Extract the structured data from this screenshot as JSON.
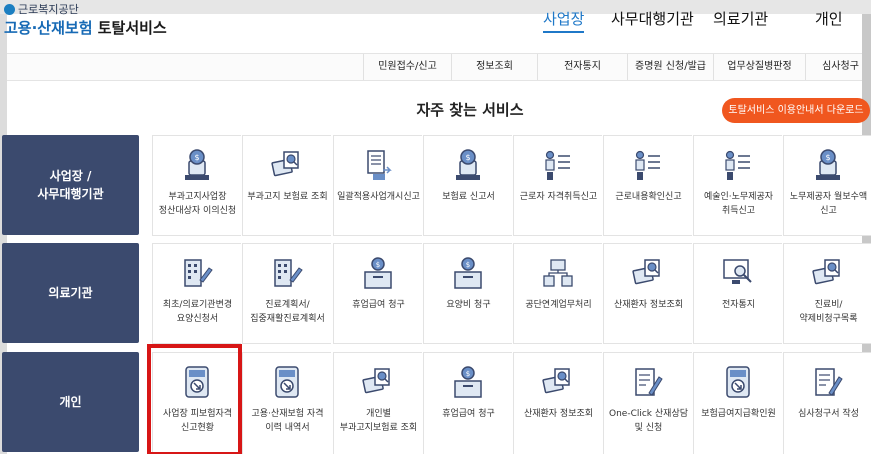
{
  "header": {
    "org_name": "근로복지공단",
    "service_name_part1": "고용·산재보험",
    "service_name_part2": "토탈서비스",
    "nav": [
      {
        "label": "사업장",
        "active": true
      },
      {
        "label": "사무대행기관",
        "active": false
      },
      {
        "label": "의료기관",
        "active": false
      },
      {
        "label": "개인",
        "active": false
      }
    ]
  },
  "subnav": [
    "민원접수/신고",
    "정보조회",
    "전자통지",
    "증명원 신청/발급",
    "업무상질병판정",
    "심사청구"
  ],
  "main": {
    "title": "자주 찾는 서비스",
    "download_button": "토탈서비스 이용안내서 다운로드"
  },
  "rows": [
    {
      "label_line1": "사업장 /",
      "label_line2": "사무대행기관",
      "tiles": [
        {
          "label": "부과고지사업장 정산대상자 이의신청",
          "icon": "money-bag-icon"
        },
        {
          "label": "부과고지 보험료 조회",
          "icon": "card-search-icon"
        },
        {
          "label": "일괄적용사업개시신고",
          "icon": "document-arrow-icon"
        },
        {
          "label": "보험료 신고서",
          "icon": "money-bag-icon"
        },
        {
          "label": "근로자 자격취득신고",
          "icon": "people-list-icon"
        },
        {
          "label": "근로내용확인신고",
          "icon": "people-list-icon"
        },
        {
          "label": "예술인·노무제공자 취득신고",
          "icon": "people-list-icon"
        },
        {
          "label": "노무제공자 월보수액 신고",
          "icon": "money-bag-icon"
        }
      ]
    },
    {
      "label_line1": "의료기관",
      "label_line2": "",
      "tiles": [
        {
          "label": "최초/의료기관변경 요양신청서",
          "icon": "building-form-icon"
        },
        {
          "label": "진료계획서/집중재활진료계획서",
          "icon": "building-form-icon"
        },
        {
          "label": "휴업급여 청구",
          "icon": "coin-box-icon"
        },
        {
          "label": "요양비 청구",
          "icon": "coin-box-icon"
        },
        {
          "label": "공단연계업무처리",
          "icon": "folder-network-icon"
        },
        {
          "label": "산재환자 정보조회",
          "icon": "card-search-icon"
        },
        {
          "label": "전자통지",
          "icon": "monitor-search-icon"
        },
        {
          "label": "진료비/약제비청구목록",
          "icon": "card-search-icon"
        }
      ]
    },
    {
      "label_line1": "개인",
      "label_line2": "",
      "tiles": [
        {
          "label": "사업장 피보험자격 신고현황",
          "icon": "document-download-icon"
        },
        {
          "label": "고용·산재보험 자격 이력 내역서",
          "icon": "document-download-icon"
        },
        {
          "label": "개인별 부과고지보험료 조회",
          "icon": "card-search-icon"
        },
        {
          "label": "휴업급여 청구",
          "icon": "coin-box-icon"
        },
        {
          "label": "산재환자 정보조회",
          "icon": "card-search-icon"
        },
        {
          "label": "One-Click 산재상담 및 신청",
          "icon": "document-pen-icon"
        },
        {
          "label": "보험급여지급확인원",
          "icon": "document-download-icon"
        },
        {
          "label": "심사청구서 작성",
          "icon": "document-pen-icon"
        }
      ]
    }
  ],
  "colors": {
    "accent": "#1f78c8",
    "row_label_bg": "#3b4a6e",
    "download_button_bg": "#f0571f",
    "highlight": "#d71616"
  }
}
